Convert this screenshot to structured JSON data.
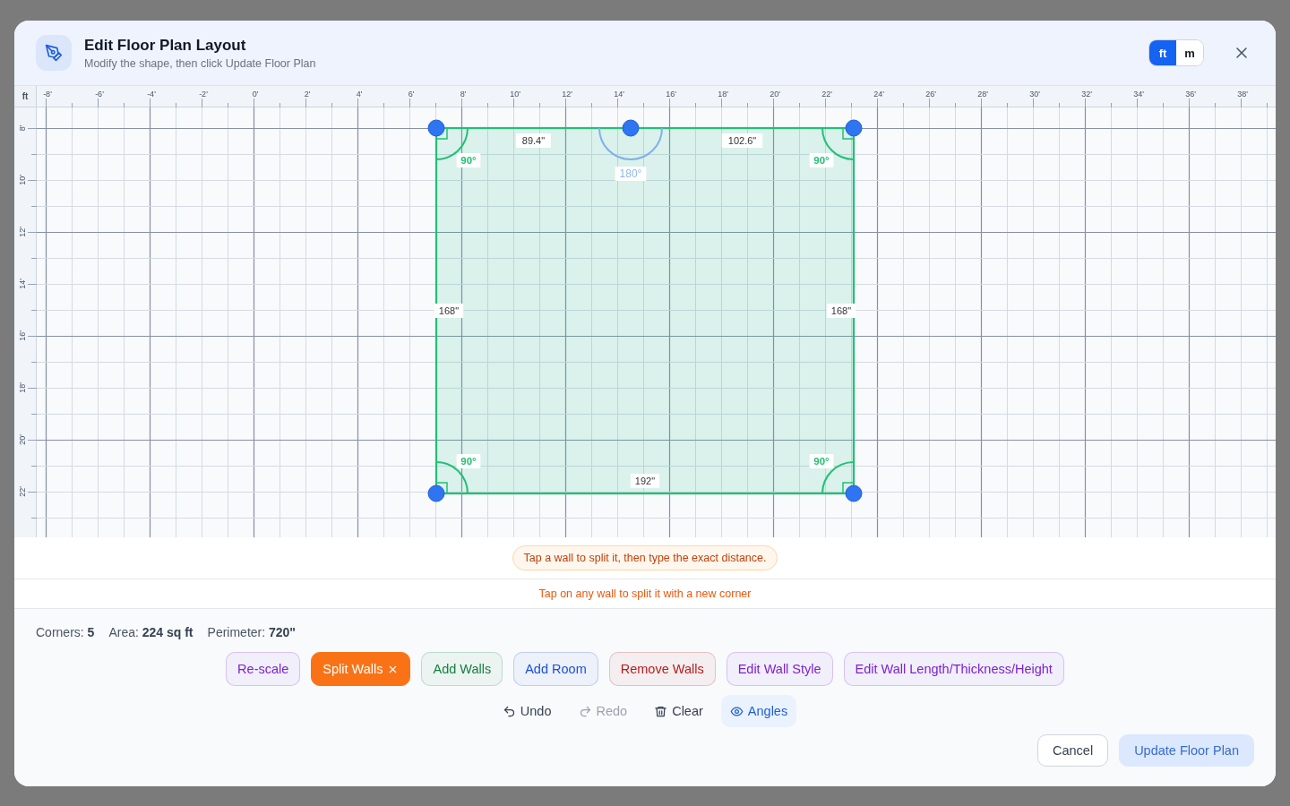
{
  "dialog": {
    "title": "Edit Floor Plan Layout",
    "subtitle": "Modify the shape, then click Update Floor Plan"
  },
  "units": [
    {
      "label": "ft",
      "selected": true
    },
    {
      "label": "m",
      "selected": false
    }
  ],
  "ruler": {
    "unit": "ft",
    "x_labels": [
      "-8'",
      "-6'",
      "-4'",
      "-2'",
      "0'",
      "2'",
      "4'",
      "6'",
      "8'",
      "10'",
      "12'",
      "14'",
      "16'",
      "18'",
      "20'",
      "22'",
      "24'",
      "26'",
      "28'",
      "30'",
      "32'",
      "34'",
      "36'",
      "38'"
    ],
    "y_labels": [
      "8'",
      "10'",
      "12'",
      "14'",
      "16'",
      "18'",
      "20'",
      "22'"
    ]
  },
  "plan": {
    "walls": [
      {
        "label": "89.4\""
      },
      {
        "label": "102.6\""
      },
      {
        "label": "168\""
      },
      {
        "label": "192\""
      },
      {
        "label": "168\""
      }
    ],
    "angles": [
      {
        "label": "90°",
        "kind": "right"
      },
      {
        "label": "180°",
        "kind": "straight"
      },
      {
        "label": "90°",
        "kind": "right"
      },
      {
        "label": "90°",
        "kind": "right"
      },
      {
        "label": "90°",
        "kind": "right"
      }
    ]
  },
  "hint": "Tap a wall to split it, then type the exact distance.",
  "mode_hint": "Tap on any wall to split it with a new corner",
  "stats": [
    {
      "label": "Corners:",
      "value": "5"
    },
    {
      "label": "Area:",
      "value": "224 sq ft"
    },
    {
      "label": "Perimeter:",
      "value": "720\""
    }
  ],
  "tools": [
    {
      "label": "Re-scale",
      "color": "#7e22ce",
      "selected": false
    },
    {
      "label": "Split Walls",
      "color": "#f97316",
      "selected": true
    },
    {
      "label": "Add Walls",
      "color": "#15803d",
      "selected": false
    },
    {
      "label": "Add Room",
      "color": "#1d4ed8",
      "selected": false
    },
    {
      "label": "Remove Walls",
      "color": "#b91c1c",
      "selected": false
    },
    {
      "label": "Edit Wall Style",
      "color": "#7e22ce",
      "selected": false
    },
    {
      "label": "Edit Wall Length/Thickness/Height",
      "color": "#7e22ce",
      "selected": false
    }
  ],
  "actions": [
    {
      "label": "Undo",
      "kind": "undo",
      "disabled": false,
      "on": false
    },
    {
      "label": "Redo",
      "kind": "redo",
      "disabled": true,
      "on": false
    },
    {
      "label": "Clear",
      "kind": "trash",
      "disabled": false,
      "on": false
    },
    {
      "label": "Angles",
      "kind": "eye",
      "disabled": false,
      "on": true
    }
  ],
  "footer": [
    {
      "label": "Cancel",
      "kind": "secondary",
      "disabled": false
    },
    {
      "label": "Update Floor Plan",
      "kind": "primary",
      "disabled": true
    }
  ]
}
